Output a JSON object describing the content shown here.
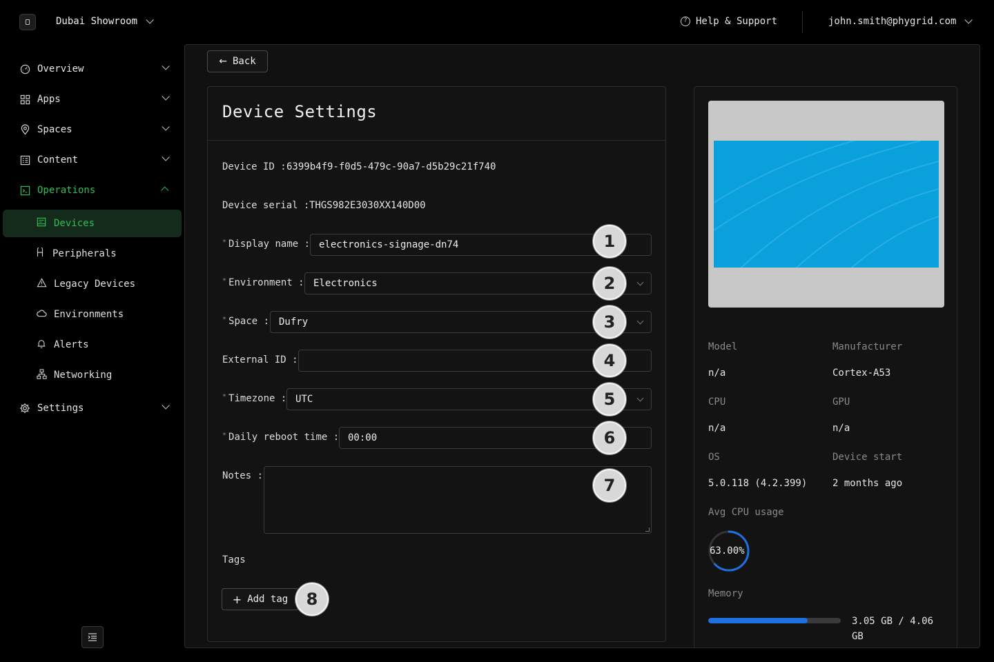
{
  "header": {
    "workspace": "Dubai Showroom",
    "help": "Help & Support",
    "user": "john.smith@phygrid.com"
  },
  "sidebar": {
    "items": [
      {
        "label": "Overview",
        "icon": "gauge-icon"
      },
      {
        "label": "Apps",
        "icon": "grid-icon"
      },
      {
        "label": "Spaces",
        "icon": "location-pin-icon"
      },
      {
        "label": "Content",
        "icon": "content-icon"
      },
      {
        "label": "Operations",
        "icon": "terminal-icon"
      },
      {
        "label": "Settings",
        "icon": "gear-icon"
      }
    ],
    "operations_children": [
      {
        "label": "Devices",
        "icon": "device-icon"
      },
      {
        "label": "Peripherals",
        "icon": "peripheral-icon"
      },
      {
        "label": "Legacy Devices",
        "icon": "warning-icon"
      },
      {
        "label": "Environments",
        "icon": "cloud-icon"
      },
      {
        "label": "Alerts",
        "icon": "bell-icon"
      },
      {
        "label": "Networking",
        "icon": "network-icon"
      }
    ]
  },
  "main": {
    "back_label": "Back",
    "title": "Device Settings",
    "device_id_label": "Device ID",
    "device_id": "6399b4f9-f0d5-479c-90a7-d5b29c21f740",
    "device_serial_label": "Device serial",
    "device_serial": "THGS982E3030XX140D00",
    "fields": {
      "display_name": {
        "label": "Display name",
        "value": "electronics-signage-dn74",
        "badge": "1"
      },
      "environment": {
        "label": "Environment",
        "value": "Electronics",
        "badge": "2"
      },
      "space": {
        "label": "Space",
        "value": "Dufry",
        "badge": "3"
      },
      "external_id": {
        "label": "External ID",
        "value": "",
        "badge": "4"
      },
      "timezone": {
        "label": "Timezone",
        "value": "UTC",
        "badge": "5"
      },
      "daily_reboot": {
        "label": "Daily reboot time",
        "value": "00:00",
        "badge": "6"
      },
      "notes": {
        "label": "Notes",
        "value": "",
        "badge": "7"
      }
    },
    "tags_label": "Tags",
    "add_tag_label": "Add tag",
    "add_tag_badge": "8"
  },
  "info": {
    "model_label": "Model",
    "model": "n/a",
    "manufacturer_label": "Manufacturer",
    "manufacturer": "Cortex-A53",
    "cpu_label": "CPU",
    "cpu": "n/a",
    "gpu_label": "GPU",
    "gpu": "n/a",
    "os_label": "OS",
    "os": "5.0.118 (4.2.399)",
    "device_start_label": "Device start",
    "device_start": "2 months ago",
    "avg_cpu_label": "Avg CPU usage",
    "avg_cpu": "63.00%",
    "avg_cpu_fraction": 0.63,
    "memory_label": "Memory",
    "memory": "3.05 GB / 4.06 GB",
    "memory_used_gb": 3.05,
    "memory_total_gb": 4.06
  },
  "colors": {
    "accent_green": "#2fbf57",
    "accent_blue": "#1e6fe0",
    "screen_blue": "#0aa0dc"
  }
}
